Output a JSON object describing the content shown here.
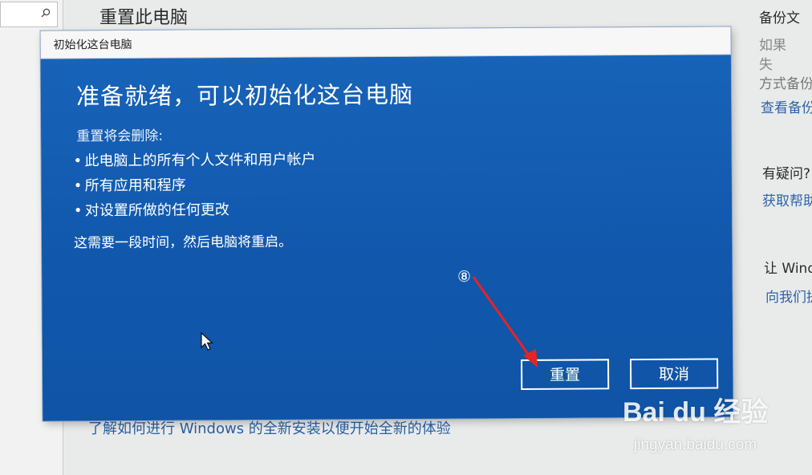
{
  "settings": {
    "page_title": "重置此电脑",
    "learn_more_link": "了解如何进行 Windows 的全新安装以便开始全新的体验",
    "sidebar": {
      "backup_heading": "备份文",
      "backup_text_1": "如果",
      "backup_text_2": "失",
      "backup_text_3": "方式备份",
      "backup_link": "查看备份",
      "question_heading": "有疑问?",
      "help_link": "获取帮助",
      "feedback_heading": "让 Wind",
      "feedback_link": "向我们提"
    }
  },
  "dialog": {
    "title": "初始化这台电脑",
    "heading": "准备就绪，可以初始化这台电脑",
    "remove_label": "重置将会删除:",
    "bullets": [
      "此电脑上的所有个人文件和用户帐户",
      "所有应用和程序",
      "对设置所做的任何更改"
    ],
    "time_note": "这需要一段时间，然后电脑将重启。",
    "reset_button": "重置",
    "cancel_button": "取消"
  },
  "annotation": {
    "step_marker": "⑧",
    "arrow_color": "#e52424"
  },
  "watermark": {
    "logo": "Bai du 经验",
    "url": "jingyan.baidu.com"
  },
  "colors": {
    "dialog_blue": "#1259b0",
    "link_blue": "#2a5fa5"
  },
  "icons": {
    "search": "search-icon",
    "pointer": "mouse-pointer-icon",
    "arrow": "annotation-arrow-icon"
  }
}
